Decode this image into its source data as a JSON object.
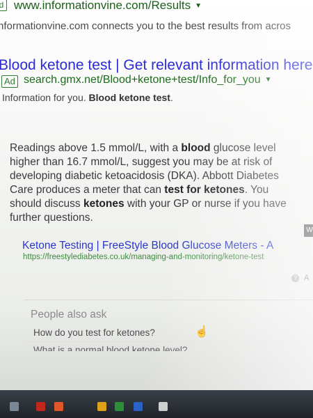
{
  "top_result": {
    "ad_badge": "d",
    "url": "www.informationvine.com/Results",
    "caret": "▼",
    "description": "nformationvine.com connects you to the best results from acros"
  },
  "ad_result": {
    "title": "Blood ketone test | Get relevant information here",
    "badge": "Ad",
    "url": "search.gmx.net/Blood+ketone+test/Info_for_you",
    "caret": "▼",
    "desc_prefix": "Information for you. ",
    "desc_bold": "Blood ketone test",
    "desc_suffix": "."
  },
  "featured_snippet": {
    "t1": "Readings above 1.5 mmol/L, with a ",
    "b1": "blood",
    "t2": " glucose level higher than 16.7 mmol/L, suggest you may be at risk of developing diabetic ketoacidosis (DKA). Abbott Diabetes Care produces a meter that can ",
    "b2": "test for ketones",
    "t3": ". You should discuss ",
    "b3": "ketones",
    "t4": " with your GP or nurse if you have further questions."
  },
  "side_tag": "W",
  "result": {
    "title": "Ketone Testing | FreeStyle Blood Glucose Meters - A",
    "url": "https://freestylediabetes.co.uk/managing-and-monitoring/ketone-test"
  },
  "help": {
    "icon_glyph": "?",
    "text": "A"
  },
  "people_also_ask": {
    "title": "People also ask",
    "questions": [
      "How do you test for ketones?",
      "What is a normal blood ketone level?"
    ]
  },
  "taskbar": {
    "icons": [
      "windows-start-icon",
      "app-icon-red",
      "app-icon-orange",
      "app-icon-yellow",
      "app-icon-green",
      "app-icon-blue",
      "app-icon-grey"
    ]
  }
}
